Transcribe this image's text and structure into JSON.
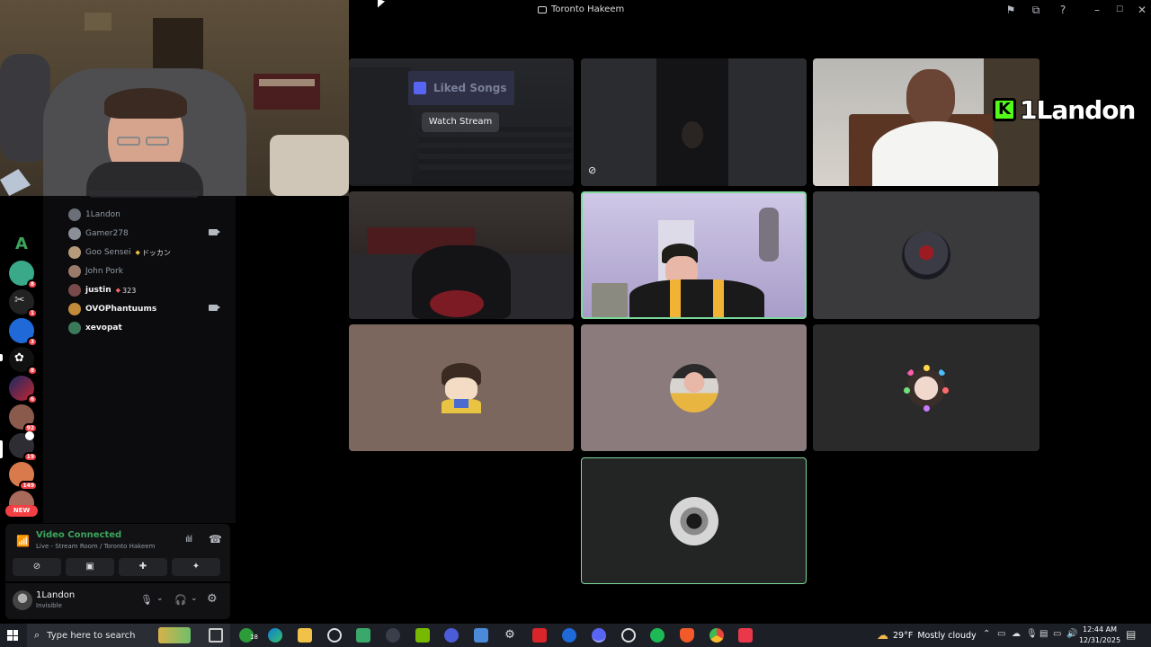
{
  "window": {
    "title": "Toronto Hakeem"
  },
  "stream_tile": {
    "preview_title": "Liked Songs",
    "watch_button": "Watch Stream"
  },
  "overlay": {
    "badge_letter": "K",
    "name": "1Landon"
  },
  "rail": {
    "badges": [
      "8",
      "1",
      "3",
      "8",
      "6",
      "92",
      "19",
      "149"
    ],
    "new_label": "NEW",
    "top_server_letter": "A"
  },
  "members": [
    {
      "name": "1Landon",
      "bright": false,
      "tag": "",
      "camera": false
    },
    {
      "name": "Gamer278",
      "bright": false,
      "tag": "",
      "camera": true
    },
    {
      "name": "Goo Sensei",
      "bright": false,
      "tag": "ドッカン",
      "camera": false
    },
    {
      "name": "John Pork",
      "bright": false,
      "tag": "",
      "camera": false
    },
    {
      "name": "justin",
      "bright": true,
      "tag": "323",
      "camera": false
    },
    {
      "name": "OVOPhantuums",
      "bright": true,
      "tag": "",
      "camera": true
    },
    {
      "name": "xevopat",
      "bright": true,
      "tag": "",
      "camera": false
    }
  ],
  "voice": {
    "status": "Video Connected",
    "location": "Live - Stream Room / Toronto Hakeem"
  },
  "user": {
    "name": "1Landon",
    "status": "Invisible"
  },
  "taskbar": {
    "search_placeholder": "Type here to search",
    "xbox_badge": "18",
    "weather_temp": "29°F",
    "weather_desc": "Mostly cloudy",
    "time": "12:44 AM",
    "date": "12/31/2025"
  },
  "colors": {
    "connected_green": "#3ba55d",
    "speaking_border": "#7dd99b",
    "badge_red": "#f23f43",
    "kick_green": "#53fc18"
  }
}
